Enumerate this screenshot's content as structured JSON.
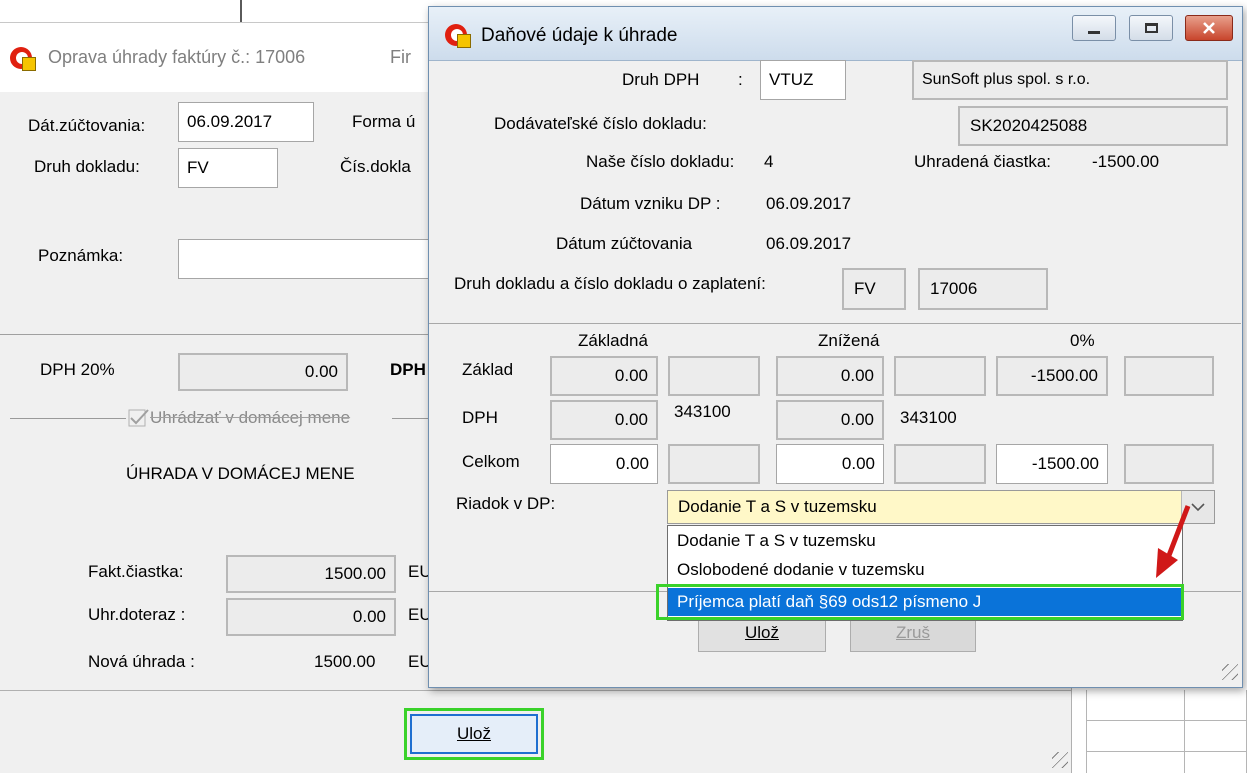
{
  "background_window": {
    "title": "Oprava úhrady faktúry č.: 17006",
    "title_suffix": "Fir",
    "dat_zuctovania": {
      "label": "Dát.zúčtovania:",
      "value": "06.09.2017"
    },
    "forma_label": "Forma ú",
    "druh_dokladu": {
      "label": "Druh dokladu:",
      "value": "FV"
    },
    "cis_dokl_label": "Čís.dokla",
    "poznamka_label": "Poznámka:",
    "poznamka_value": "",
    "dph20": {
      "label": "DPH 20%",
      "value": "0.00"
    },
    "dph_cut_label": "DPH",
    "uhradzat_checkbox": {
      "label": "Uhrádzať v domácej mene",
      "checked": true
    },
    "section_heading": "ÚHRADA V DOMÁCEJ MENE",
    "fakt_ciastka": {
      "label": "Fakt.čiastka:",
      "value": "1500.00",
      "currency_cut": "EU"
    },
    "uhr_doteraz": {
      "label": "Uhr.doteraz :",
      "value": "0.00",
      "currency_cut": "EU"
    },
    "nova_uhrada": {
      "label": "Nová úhrada :",
      "value": "1500.00",
      "currency_cut": "EU"
    },
    "save_button": "Ulož"
  },
  "dialog": {
    "title": "Daňové údaje k úhrade",
    "druh_dph": {
      "label": "Druh DPH",
      "colon": ":",
      "value": "VTUZ"
    },
    "company": "SunSoft plus spol. s r.o.",
    "dodavatelske_cislo": {
      "label": "Dodávateľské číslo dokladu:",
      "value": "SK2020425088"
    },
    "nase_cislo": {
      "label": "Naše číslo dokladu:",
      "value": "4"
    },
    "uhradena_ciastka": {
      "label": "Uhradená čiastka:",
      "value": "-1500.00"
    },
    "datum_vzniku": {
      "label": "Dátum vzniku DP :",
      "value": "06.09.2017"
    },
    "datum_zuctovania": {
      "label": "Dátum  zúčtovania",
      "value": "06.09.2017"
    },
    "druh_cislo_zaplatenia": {
      "label": "Druh dokladu a číslo dokladu o  zaplatení:",
      "druh": "FV",
      "cislo": "17006"
    },
    "columns": {
      "zakladna": "Základná",
      "znizena": "Znížená",
      "nula": "0%"
    },
    "rows": {
      "zaklad": {
        "label": "Základ",
        "zakladna": "0.00",
        "znizena": "0.00",
        "nula": "-1500.00"
      },
      "dph": {
        "label": "DPH",
        "zakladna": "0.00",
        "ucet_zakladna": "343100",
        "znizena": "0.00",
        "ucet_znizena": "343100"
      },
      "celkom": {
        "label": "Celkom",
        "zakladna": "0.00",
        "znizena": "0.00",
        "nula": "-1500.00"
      }
    },
    "riadok_dp": {
      "label": "Riadok v DP:",
      "selected": "Dodanie T a S v tuzemsku",
      "options": [
        "Dodanie T a S v tuzemsku",
        "Oslobodené dodanie v tuzemsku",
        "Príjemca platí daň §69 ods12 písmeno J"
      ]
    },
    "save_button": "Ulož",
    "cancel_button": "Zruš"
  },
  "colors": {
    "highlight_box": "#3ad22a",
    "selection": "#0a73d9",
    "arrow": "#d01818",
    "combo_bg": "#fff8c8"
  }
}
